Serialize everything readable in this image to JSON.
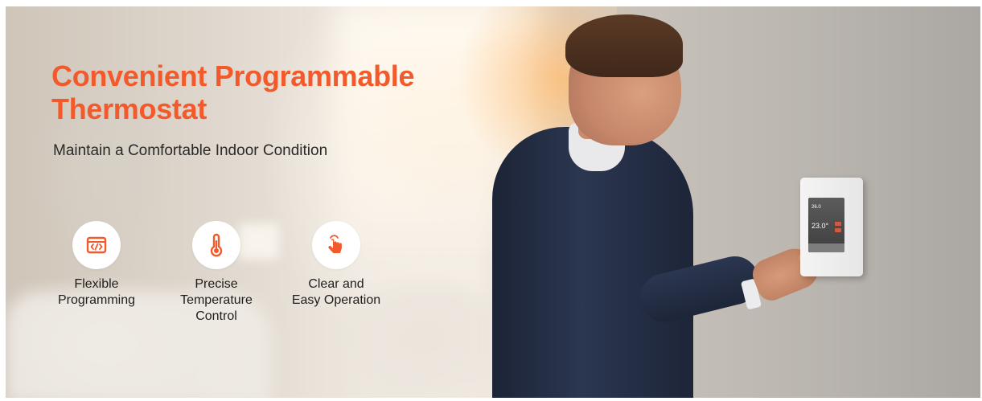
{
  "banner": {
    "title_line1": "Convenient Programmable",
    "title_line2": "Thermostat",
    "subtitle": "Maintain a Comfortable Indoor Condition",
    "accent_color": "#f25a2b"
  },
  "features": [
    {
      "label": "Flexible\nProgramming",
      "icon": "code-window-icon"
    },
    {
      "label": "Precise\nTemperature\nControl",
      "icon": "thermometer-icon"
    },
    {
      "label": "Clear and\nEasy Operation",
      "icon": "touch-hand-icon"
    }
  ],
  "thermostat_screen": {
    "top_temp": "26.0",
    "main_temp": "23.0°"
  }
}
